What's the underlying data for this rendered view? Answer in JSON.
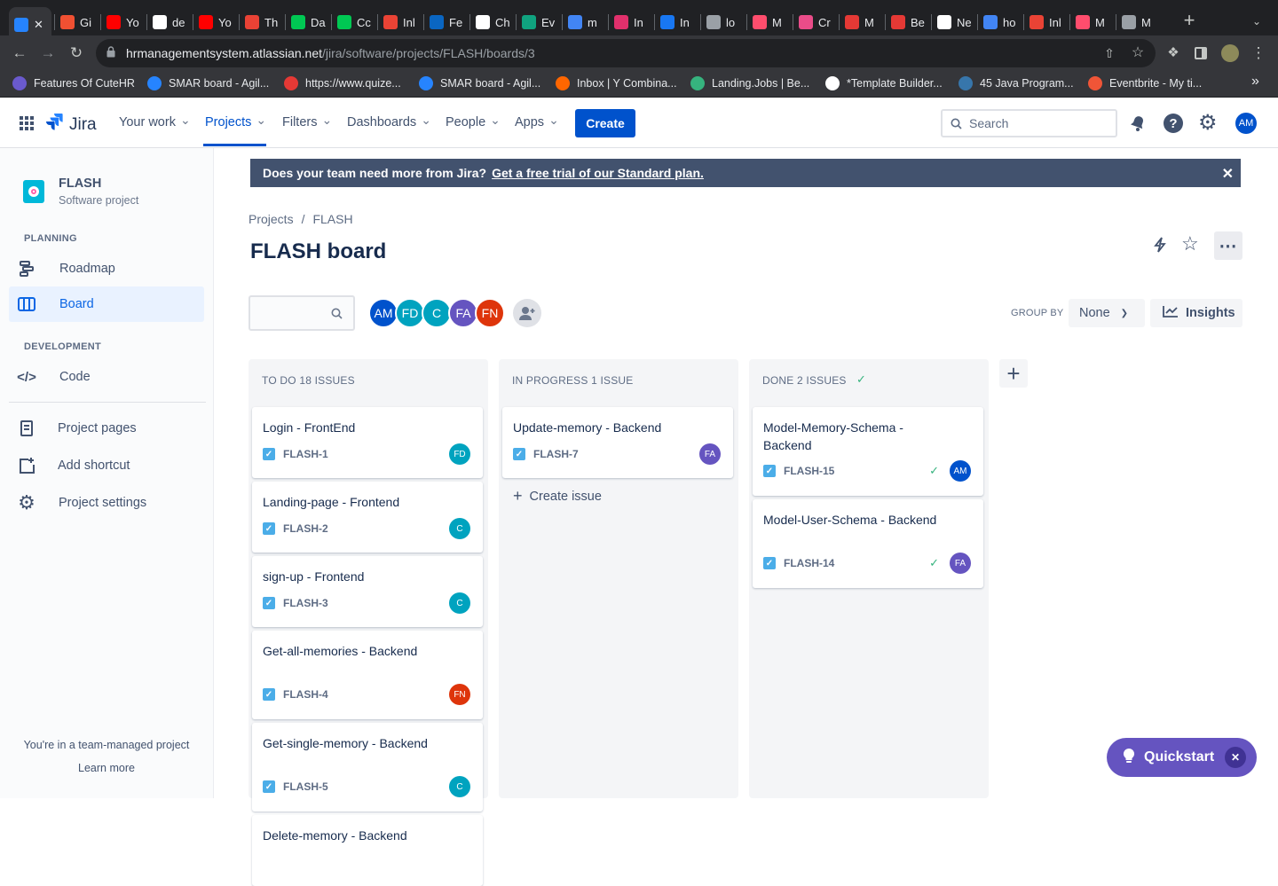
{
  "browser": {
    "tabs": [
      {
        "label": "",
        "color": "#2684ff",
        "active": true
      },
      {
        "label": "Gi",
        "color": "#f05032"
      },
      {
        "label": "Yo",
        "color": "#ff0000"
      },
      {
        "label": "de",
        "color": "#ffffff"
      },
      {
        "label": "Yo",
        "color": "#ff0000"
      },
      {
        "label": "Th",
        "color": "#e94235"
      },
      {
        "label": "Da",
        "color": "#00c853"
      },
      {
        "label": "Cc",
        "color": "#00c853"
      },
      {
        "label": "Inl",
        "color": "#ea4335"
      },
      {
        "label": "Fe",
        "color": "#0a66c2"
      },
      {
        "label": "Ch",
        "color": "#ffffff"
      },
      {
        "label": "Ev",
        "color": "#10a37f"
      },
      {
        "label": "m",
        "color": "#4285f4"
      },
      {
        "label": "In",
        "color": "#e1306c"
      },
      {
        "label": "In",
        "color": "#1877f2"
      },
      {
        "label": "lo",
        "color": "#9aa0a6"
      },
      {
        "label": "M",
        "color": "#ff4d6d"
      },
      {
        "label": "Cr",
        "color": "#ea4c89"
      },
      {
        "label": "M",
        "color": "#e53935"
      },
      {
        "label": "Be",
        "color": "#e53935"
      },
      {
        "label": "Ne",
        "color": "#ffffff"
      },
      {
        "label": "ho",
        "color": "#4285f4"
      },
      {
        "label": "Inl",
        "color": "#ea4335"
      },
      {
        "label": "M",
        "color": "#ff4d6d"
      },
      {
        "label": "M",
        "color": "#9aa0a6"
      }
    ],
    "url_host": "hrmanagementsystem.atlassian.net",
    "url_path": "/jira/software/projects/FLASH/boards/3",
    "bookmarks": [
      {
        "label": "Features Of CuteHR",
        "color": "#6a5acd"
      },
      {
        "label": "SMAR board - Agil...",
        "color": "#2684ff"
      },
      {
        "label": "https://www.quize...",
        "color": "#e53935"
      },
      {
        "label": "SMAR board - Agil...",
        "color": "#2684ff"
      },
      {
        "label": "Inbox | Y Combina...",
        "color": "#ff6600"
      },
      {
        "label": "Landing.Jobs | Be...",
        "color": "#36b37e"
      },
      {
        "label": "*Template Builder...",
        "color": "#ffffff"
      },
      {
        "label": "45 Java Program...",
        "color": "#3776ab"
      },
      {
        "label": "Eventbrite - My ti...",
        "color": "#f05537"
      }
    ],
    "more_bookmarks": "»"
  },
  "topnav": {
    "logo": "Jira",
    "items": [
      "Your work",
      "Projects",
      "Filters",
      "Dashboards",
      "People",
      "Apps"
    ],
    "create": "Create",
    "search_placeholder": "Search",
    "user_initials": "AM"
  },
  "sidebar": {
    "project_name": "FLASH",
    "project_type": "Software project",
    "planning_heading": "PLANNING",
    "roadmap": "Roadmap",
    "board": "Board",
    "development_heading": "DEVELOPMENT",
    "code": "Code",
    "project_pages": "Project pages",
    "add_shortcut": "Add shortcut",
    "project_settings": "Project settings",
    "footer_text": "You're in a team-managed project",
    "learn_more": "Learn more"
  },
  "main": {
    "banner_text": "Does your team need more from Jira?",
    "banner_link": "Get a free trial of our Standard plan.",
    "breadcrumb_root": "Projects",
    "breadcrumb_sep": "/",
    "breadcrumb_project": "FLASH",
    "title": "FLASH board",
    "members": [
      {
        "initials": "AM",
        "color": "#0052cc"
      },
      {
        "initials": "FD",
        "color": "#00a3bf"
      },
      {
        "initials": "C",
        "color": "#00a3bf"
      },
      {
        "initials": "FA",
        "color": "#6554c0"
      },
      {
        "initials": "FN",
        "color": "#de350b"
      }
    ],
    "group_by_label": "GROUP BY",
    "group_by_value": "None",
    "insights": "Insights",
    "quickstart": "Quickstart"
  },
  "columns": [
    {
      "header": "TO DO 18 ISSUES",
      "done": false,
      "cards": [
        {
          "title": "Login - FrontEnd",
          "key": "FLASH-1",
          "assignee": "FD",
          "color": "#00a3bf"
        },
        {
          "title": "Landing-page - Frontend",
          "key": "FLASH-2",
          "assignee": "C",
          "color": "#00a3bf"
        },
        {
          "title": "sign-up - Frontend",
          "key": "FLASH-3",
          "assignee": "C",
          "color": "#00a3bf"
        },
        {
          "title": "Get-all-memories - Backend",
          "key": "FLASH-4",
          "assignee": "FN",
          "color": "#de350b"
        },
        {
          "title": "Get-single-memory - Backend",
          "key": "FLASH-5",
          "assignee": "C",
          "color": "#00a3bf"
        },
        {
          "title": "Delete-memory - Backend",
          "key": "",
          "assignee": "",
          "color": "#ffffff"
        }
      ]
    },
    {
      "header": "IN PROGRESS 1 ISSUE",
      "done": false,
      "create_issue": "Create issue",
      "cards": [
        {
          "title": "Update-memory - Backend",
          "key": "FLASH-7",
          "assignee": "FA",
          "color": "#6554c0"
        }
      ]
    },
    {
      "header": "DONE 2 ISSUES",
      "done": true,
      "cards": [
        {
          "title": "Model-Memory-Schema - Backend",
          "key": "FLASH-15",
          "assignee": "AM",
          "color": "#0052cc"
        },
        {
          "title": "Model-User-Schema - Backend",
          "key": "FLASH-14",
          "assignee": "FA",
          "color": "#6554c0"
        }
      ]
    }
  ]
}
